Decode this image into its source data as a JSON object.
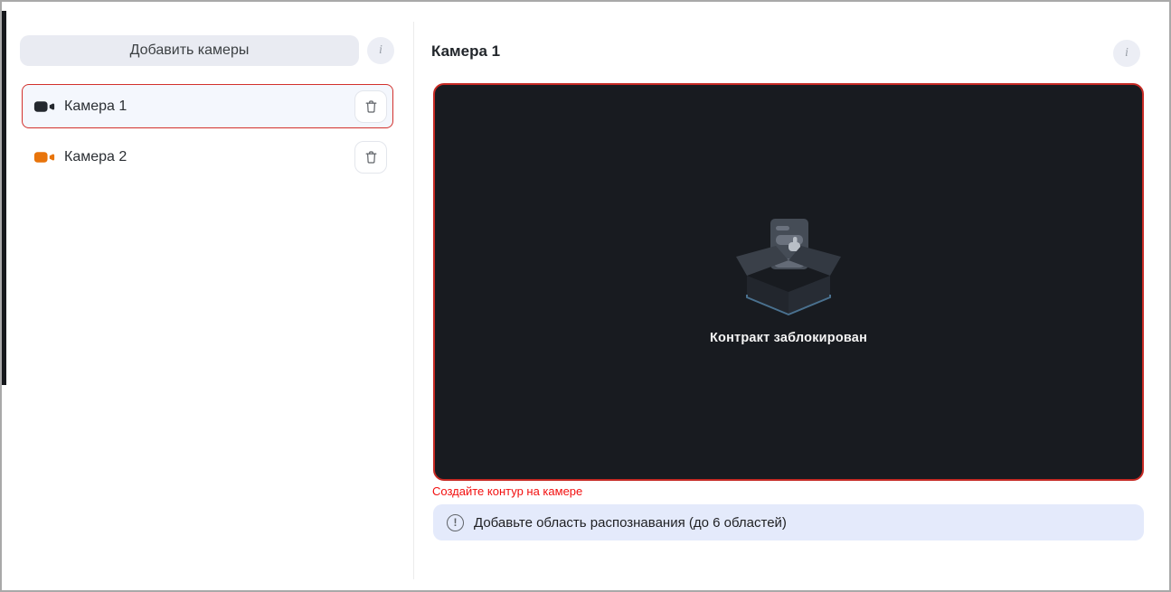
{
  "sidebar": {
    "add_button_label": "Добавить камеры",
    "info_icon_glyph": "i",
    "cameras": [
      {
        "name": "Камера 1",
        "selected": true
      },
      {
        "name": "Камера 2",
        "selected": false
      }
    ]
  },
  "main": {
    "title": "Камера 1",
    "info_icon_glyph": "i",
    "video_placeholder": {
      "icon": "empty-box-icon",
      "text": "Контракт заблокирован"
    },
    "error_text": "Создайте контур на камере",
    "banner": {
      "icon": "alert-circle-icon",
      "icon_glyph": "!",
      "text": "Добавьте область распознавания (до 6 областей)"
    }
  },
  "colors": {
    "selected_border": "#d2302c",
    "video_border": "#c62a24",
    "error_text": "#f20f0f",
    "selected_bg": "#f4f7fd",
    "button_bg": "#e9ebf2",
    "banner_bg": "#e4eafb",
    "video_bg": "#181b20",
    "camera1_icon": "#24282e",
    "camera2_icon": "#e8740b"
  }
}
